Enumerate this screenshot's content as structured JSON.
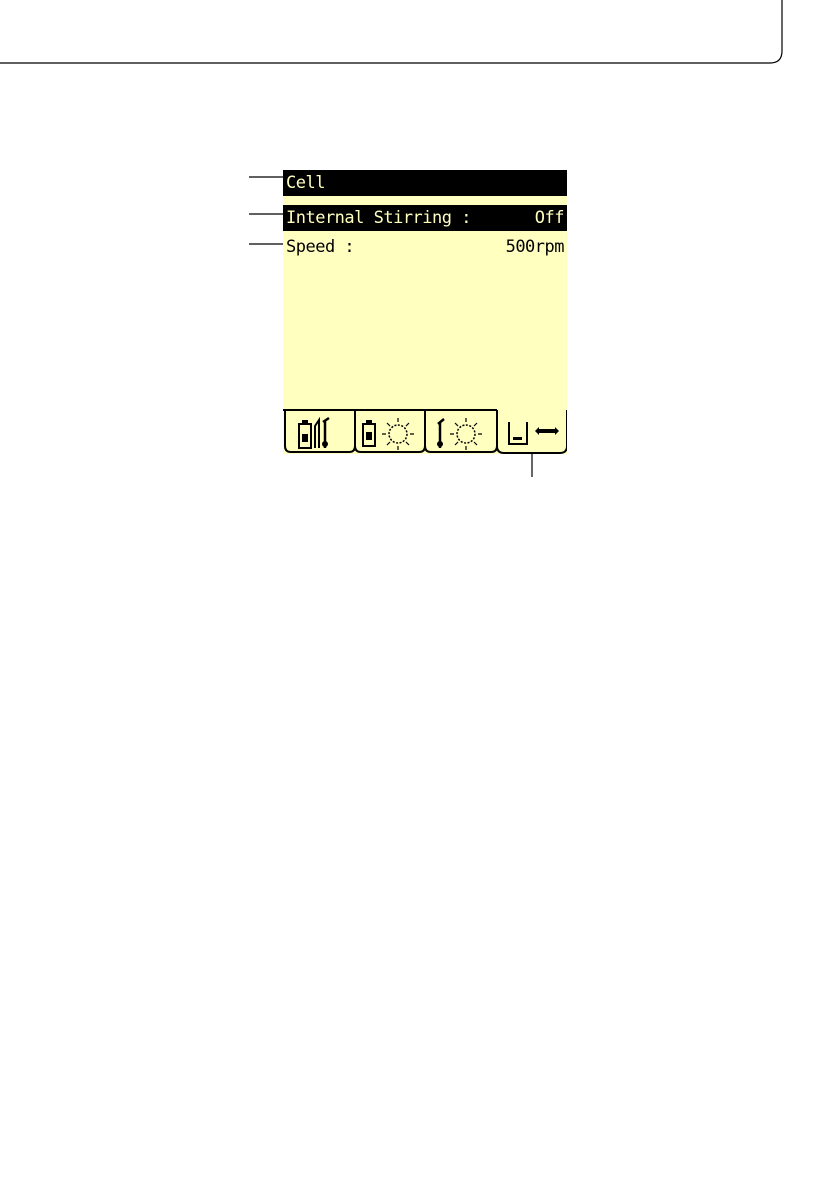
{
  "screen": {
    "title": "Cell",
    "settings": [
      {
        "label": "Internal Stirring :",
        "value": "Off",
        "selected": true
      },
      {
        "label": "Speed :",
        "value": "500rpm",
        "selected": false
      }
    ],
    "tabs": [
      {
        "icon": "bottle-probe-icon",
        "active": false
      },
      {
        "icon": "bottle-sun-icon",
        "active": false
      },
      {
        "icon": "probe-sun-icon",
        "active": false
      },
      {
        "icon": "beaker-stirring-icon",
        "active": true
      }
    ]
  },
  "colors": {
    "screen_background": "#ffffc0",
    "highlight": "#000000",
    "line": "#000000"
  }
}
